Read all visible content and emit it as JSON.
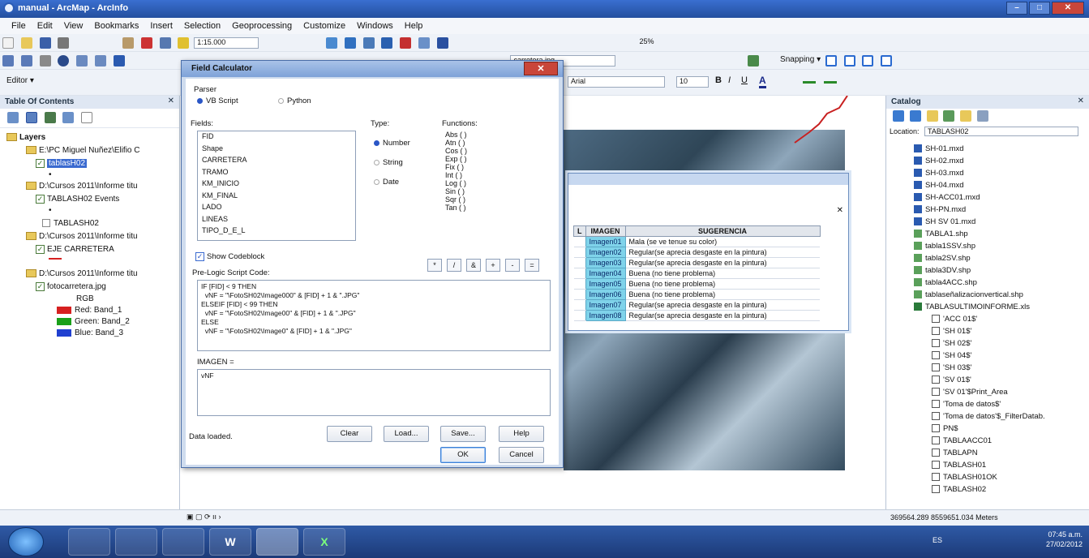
{
  "window": {
    "title": "manual - ArcMap - ArcInfo",
    "min": "–",
    "max": "□",
    "close": "✕"
  },
  "menu": [
    "File",
    "Edit",
    "View",
    "Bookmarks",
    "Insert",
    "Selection",
    "Geoprocessing",
    "Customize",
    "Windows",
    "Help"
  ],
  "toolbar": {
    "scale": "1:15.000",
    "layer_select": "carretera.jpg",
    "font": "Arial",
    "font_size": "10",
    "zoom": "25%",
    "snapping": "Snapping ▾",
    "editor": "Editor ▾"
  },
  "toc": {
    "title": "Table Of Contents",
    "close": "✕",
    "layers_label": "Layers",
    "items": [
      "E:\\PC Miguel Nuñez\\Elifio C",
      "tablasH02",
      "D:\\Cursos 2011\\Informe titu",
      "TABLASH02 Events",
      "TABLASH02",
      "D:\\Cursos 2011\\Informe titu",
      "EJE CARRETERA",
      "D:\\Cursos 2011\\Informe titu",
      "fotocarretera.jpg",
      "RGB",
      "Red: Band_1",
      "Green: Band_2",
      "Blue: Band_3"
    ]
  },
  "field_calculator": {
    "title": "Field Calculator",
    "close": "✕",
    "parser_label": "Parser",
    "parser_vb": "VB Script",
    "parser_python": "Python",
    "fields_label": "Fields:",
    "fields": [
      "FID",
      "Shape",
      "CARRETERA",
      "TRAMO",
      "KM_INICIO",
      "KM_FINAL",
      "LADO",
      "LINEAS",
      "TIPO_D_E_L"
    ],
    "type_label": "Type:",
    "types": [
      "Number",
      "String",
      "Date"
    ],
    "functions_label": "Functions:",
    "functions": [
      "Abs ( )",
      "Atn ( )",
      "Cos ( )",
      "Exp ( )",
      "Fix ( )",
      "Int ( )",
      "Log ( )",
      "Sin ( )",
      "Sqr ( )",
      "Tan ( )"
    ],
    "show_codeblock": "Show Codeblock",
    "operators": [
      "*",
      "/",
      "&",
      "+",
      "-",
      "="
    ],
    "prelogic_label": "Pre-Logic Script Code:",
    "prelogic_code": "IF [FID] < 9 THEN\n  vNF = \"\\FotoSH02\\Image000\" & [FID] + 1 & \".JPG\"\nELSEIF [FID] < 99 THEN\n  vNF = \"\\FotoSH02\\Image00\" & [FID] + 1 & \".JPG\"\nELSE\n  vNF = \"\\FotoSH02\\Image0\" & [FID] + 1 & \".JPG\"",
    "expression_label": "IMAGEN =",
    "expression": "vNF",
    "buttons": {
      "clear": "Clear",
      "load": "Load...",
      "save": "Save...",
      "help": "Help",
      "ok": "OK",
      "cancel": "Cancel"
    },
    "status": "Data loaded."
  },
  "attribute_table": {
    "columns": [
      "L",
      "IMAGEN",
      "SUGERENCIA"
    ],
    "rows": [
      [
        "",
        "Imagen01",
        "Mala (se ve tenue su color)"
      ],
      [
        "",
        "Imagen02",
        "Regular(se aprecia desgaste en la pintura)"
      ],
      [
        "",
        "Imagen03",
        "Regular(se aprecia desgaste en la pintura)"
      ],
      [
        "",
        "Imagen04",
        "Buena (no tiene problema)"
      ],
      [
        "",
        "Imagen05",
        "Buena (no tiene problema)"
      ],
      [
        "",
        "Imagen06",
        "Buena (no tiene problema)"
      ],
      [
        "",
        "Imagen07",
        "Regular(se aprecia desgaste en la pintura)"
      ],
      [
        "",
        "Imagen08",
        "Regular(se aprecia desgaste en la pintura)"
      ]
    ]
  },
  "catalog": {
    "title": "Catalog",
    "close": "✕",
    "location_label": "Location:",
    "location": "TABLASH02",
    "items": [
      {
        "name": "SH-01.mxd",
        "type": "mxd"
      },
      {
        "name": "SH-02.mxd",
        "type": "mxd"
      },
      {
        "name": "SH-03.mxd",
        "type": "mxd"
      },
      {
        "name": "SH-04.mxd",
        "type": "mxd"
      },
      {
        "name": "SH-ACC01.mxd",
        "type": "mxd"
      },
      {
        "name": "SH-PN.mxd",
        "type": "mxd"
      },
      {
        "name": "SH SV 01.mxd",
        "type": "mxd"
      },
      {
        "name": "TABLA1.shp",
        "type": "shp"
      },
      {
        "name": "tabla1SSV.shp",
        "type": "shp"
      },
      {
        "name": "tabla2SV.shp",
        "type": "shp"
      },
      {
        "name": "tabla3DV.shp",
        "type": "shp"
      },
      {
        "name": "tabla4ACC.shp",
        "type": "shp"
      },
      {
        "name": "tablaseñalizacionvertical.shp",
        "type": "shp"
      },
      {
        "name": "TABLASULTIMOINFORME.xls",
        "type": "xls"
      },
      {
        "name": "'ACC 01$'",
        "type": "tbl"
      },
      {
        "name": "'SH 01$'",
        "type": "tbl"
      },
      {
        "name": "'SH 02$'",
        "type": "tbl"
      },
      {
        "name": "'SH 04$'",
        "type": "tbl"
      },
      {
        "name": "'SH 03$'",
        "type": "tbl"
      },
      {
        "name": "'SV 01$'",
        "type": "tbl"
      },
      {
        "name": "'SV 01'$Print_Area",
        "type": "tbl"
      },
      {
        "name": "'Toma de datos$'",
        "type": "tbl"
      },
      {
        "name": "'Toma de datos'$_FilterDatab.",
        "type": "tbl"
      },
      {
        "name": "PN$",
        "type": "tbl"
      },
      {
        "name": "TABLAACC01",
        "type": "tbl"
      },
      {
        "name": "TABLAPN",
        "type": "tbl"
      },
      {
        "name": "TABLASH01",
        "type": "tbl"
      },
      {
        "name": "TABLASH01OK",
        "type": "tbl"
      },
      {
        "name": "TABLASH02",
        "type": "tbl"
      }
    ]
  },
  "status_bar": {
    "coords": "369564.289  8559651.034 Meters"
  },
  "taskbar": {
    "apps": [
      "explorer",
      "media",
      "paint",
      "W",
      "arcmap",
      "X"
    ],
    "lang": "ES",
    "time": "07:45 a.m.",
    "date": "27/02/2012"
  },
  "colors": {
    "title_bar": "#2a58ad",
    "highlight": "#7fd3ea",
    "red_band": "#d62020",
    "green_band": "#1aa01a",
    "blue_band": "#2040d0"
  }
}
